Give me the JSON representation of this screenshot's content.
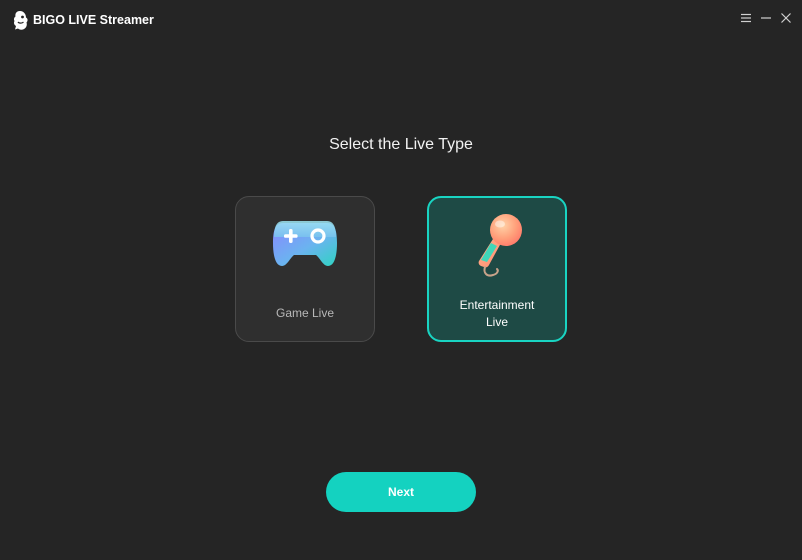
{
  "app": {
    "title": "BIGO LIVE Streamer",
    "logo_icon": "bigo-mascot-icon"
  },
  "window_controls": {
    "menu_icon": "menu-icon",
    "minimize_icon": "minimize-icon",
    "close_icon": "close-icon"
  },
  "main": {
    "heading": "Select the Live Type",
    "options": [
      {
        "label": "Game Live",
        "icon": "gamepad-icon",
        "selected": false
      },
      {
        "label": "Entertainment Live",
        "icon": "microphone-icon",
        "selected": true
      }
    ],
    "next_label": "Next"
  },
  "colors": {
    "background": "#252525",
    "accent": "#14d2c0",
    "selected_card_bg": "#1e4a45",
    "unselected_card_bg": "#2f2f2f"
  }
}
